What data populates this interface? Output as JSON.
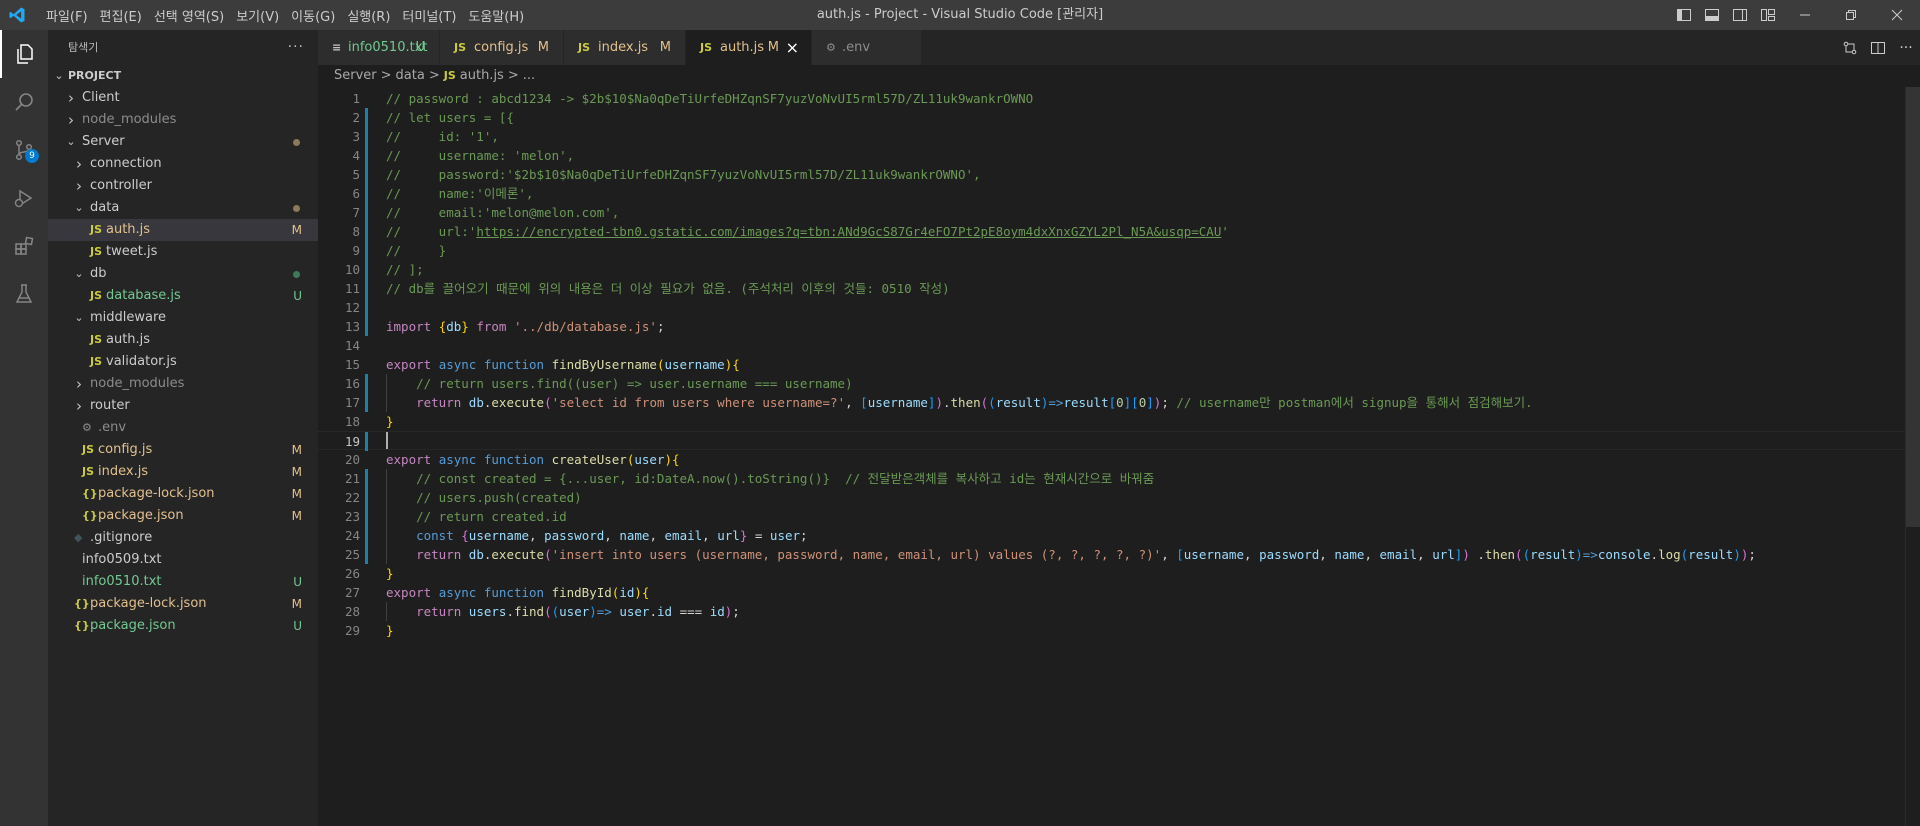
{
  "window": {
    "title": "auth.js - Project - Visual Studio Code [관리자]",
    "menu": [
      "파일(F)",
      "편집(E)",
      "선택 영역(S)",
      "보기(V)",
      "이동(G)",
      "실행(R)",
      "터미널(T)",
      "도움말(H)"
    ]
  },
  "colors": {
    "accent": "#007acc",
    "modified": "#e2c08d",
    "untracked": "#73c991",
    "editor_bg": "#1e1e1e",
    "sidebar_bg": "#252526"
  },
  "activity": {
    "scm_badge": "9"
  },
  "explorer": {
    "title": "탐색기",
    "more": "···",
    "project": "PROJECT",
    "items": [
      {
        "label": "Client",
        "kind": "folder",
        "open": false,
        "depth": 1,
        "status": ""
      },
      {
        "label": "node_modules",
        "kind": "folder",
        "open": false,
        "depth": 1,
        "status": "",
        "dim": true
      },
      {
        "label": "Server",
        "kind": "folder",
        "open": true,
        "depth": 1,
        "status": "dot"
      },
      {
        "label": "connection",
        "kind": "folder",
        "open": false,
        "depth": 2,
        "status": ""
      },
      {
        "label": "controller",
        "kind": "folder",
        "open": false,
        "depth": 2,
        "status": ""
      },
      {
        "label": "data",
        "kind": "folder",
        "open": true,
        "depth": 2,
        "status": "dot"
      },
      {
        "label": "auth.js",
        "kind": "js",
        "depth": 3,
        "status": "M",
        "selected": true
      },
      {
        "label": "tweet.js",
        "kind": "js",
        "depth": 3,
        "status": ""
      },
      {
        "label": "db",
        "kind": "folder",
        "open": true,
        "depth": 2,
        "status": "dot-green"
      },
      {
        "label": "database.js",
        "kind": "js",
        "depth": 3,
        "status": "U"
      },
      {
        "label": "middleware",
        "kind": "folder",
        "open": true,
        "depth": 2,
        "status": ""
      },
      {
        "label": "auth.js",
        "kind": "js",
        "depth": 3,
        "status": ""
      },
      {
        "label": "validator.js",
        "kind": "js",
        "depth": 3,
        "status": ""
      },
      {
        "label": "node_modules",
        "kind": "folder",
        "open": false,
        "depth": 2,
        "status": "",
        "dim": true
      },
      {
        "label": "router",
        "kind": "folder",
        "open": false,
        "depth": 2,
        "status": ""
      },
      {
        "label": ".env",
        "kind": "env",
        "depth": 2,
        "status": "",
        "dim": true
      },
      {
        "label": "config.js",
        "kind": "js",
        "depth": 2,
        "status": "M"
      },
      {
        "label": "index.js",
        "kind": "js",
        "depth": 2,
        "status": "M"
      },
      {
        "label": "package-lock.json",
        "kind": "json",
        "depth": 2,
        "status": "M"
      },
      {
        "label": "package.json",
        "kind": "json",
        "depth": 2,
        "status": "M"
      },
      {
        "label": ".gitignore",
        "kind": "git",
        "depth": 1,
        "status": ""
      },
      {
        "label": "info0509.txt",
        "kind": "txt",
        "depth": 1,
        "status": ""
      },
      {
        "label": "info0510.txt",
        "kind": "txt",
        "depth": 1,
        "status": "U"
      },
      {
        "label": "package-lock.json",
        "kind": "json",
        "depth": 1,
        "status": "M"
      },
      {
        "label": "package.json",
        "kind": "json",
        "depth": 1,
        "status": "U"
      }
    ]
  },
  "tabs": [
    {
      "label": "info0510.txt",
      "status": "U",
      "kind": "txt"
    },
    {
      "label": "config.js",
      "status": "M",
      "kind": "js"
    },
    {
      "label": "index.js",
      "status": "M",
      "kind": "js"
    },
    {
      "label": "auth.js",
      "status": "M",
      "kind": "js",
      "active": true,
      "close": "×"
    },
    {
      "label": ".env",
      "status": "",
      "kind": "env"
    }
  ],
  "breadcrumb": [
    "Server",
    ">",
    "data",
    ">",
    "JS",
    "auth.js",
    ">",
    "..."
  ],
  "editor": {
    "cursor_line": 19,
    "lines": [
      [
        [
          "cm",
          "// password : abcd1234 -> $2b$10$Na0qDeTiUrfeDHZqnSF7yuzVoNvUI5rml57D/ZL11uk9wankrOWNO"
        ]
      ],
      [
        [
          "cm",
          "// let users = [{"
        ]
      ],
      [
        [
          "cm",
          "//     id: '1',"
        ]
      ],
      [
        [
          "cm",
          "//     username: 'melon',"
        ]
      ],
      [
        [
          "cm",
          "//     password:'$2b$10$Na0qDeTiUrfeDHZqnSF7yuzVoNvUI5rml57D/ZL11uk9wankrOWNO',"
        ]
      ],
      [
        [
          "cm",
          "//     name:'이메론',"
        ]
      ],
      [
        [
          "cm",
          "//     email:'melon@melon.com',"
        ]
      ],
      [
        [
          "cm",
          "//     url:'"
        ],
        [
          "cmu",
          "https://encrypted-tbn0.gstatic.com/images?q=tbn:ANd9GcS87Gr4eFO7Pt2pE8oym4dxXnxGZYL2Pl_N5A&usqp=CAU"
        ],
        [
          "cm",
          "'"
        ]
      ],
      [
        [
          "cm",
          "//     }"
        ]
      ],
      [
        [
          "cm",
          "// ];"
        ]
      ],
      [
        [
          "cm",
          "// db를 끌어오기 때문에 위의 내용은 더 이상 필요가 없음. (주석처리 이후의 것들: 0510 작성)"
        ]
      ],
      [],
      [
        [
          "k2",
          "import "
        ],
        [
          "p1",
          "{"
        ],
        [
          "vr",
          "db"
        ],
        [
          "p1",
          "}"
        ],
        [
          "k2",
          " from "
        ],
        [
          "st2",
          "'../db/database.js'"
        ],
        [
          "pl",
          ";"
        ]
      ],
      [],
      [
        [
          "k2",
          "export "
        ],
        [
          "k1",
          "async function "
        ],
        [
          "fn",
          "findByUsername"
        ],
        [
          "p1",
          "("
        ],
        [
          "vr",
          "username"
        ],
        [
          "p1",
          "){"
        ]
      ],
      [
        [
          "pl",
          "    "
        ],
        [
          "cm",
          "// return users.find((user) => user.username === username)"
        ]
      ],
      [
        [
          "pl",
          "    "
        ],
        [
          "k2",
          "return "
        ],
        [
          "vr",
          "db"
        ],
        [
          "pl",
          "."
        ],
        [
          "fn",
          "execute"
        ],
        [
          "p2",
          "("
        ],
        [
          "st2",
          "'select id from users where username=?'"
        ],
        [
          "pl",
          ", "
        ],
        [
          "p3",
          "["
        ],
        [
          "vr",
          "username"
        ],
        [
          "p3",
          "]"
        ],
        [
          "p2",
          ")"
        ],
        [
          "pl",
          "."
        ],
        [
          "fn",
          "then"
        ],
        [
          "p2",
          "("
        ],
        [
          "p3",
          "("
        ],
        [
          "vr",
          "result"
        ],
        [
          "p3",
          ")"
        ],
        [
          "k1",
          "=>"
        ],
        [
          "vr",
          "result"
        ],
        [
          "p3",
          "["
        ],
        [
          "nm",
          "0"
        ],
        [
          "p3",
          "]["
        ],
        [
          "nm",
          "0"
        ],
        [
          "p3",
          "]"
        ],
        [
          "p2",
          ")"
        ],
        [
          "pl",
          "; "
        ],
        [
          "cm",
          "// username만 postman에서 signup을 통해서 점검해보기."
        ]
      ],
      [
        [
          "p1",
          "}"
        ]
      ],
      [],
      [
        [
          "k2",
          "export "
        ],
        [
          "k1",
          "async function "
        ],
        [
          "fn",
          "createUser"
        ],
        [
          "p1",
          "("
        ],
        [
          "vr",
          "user"
        ],
        [
          "p1",
          "){"
        ]
      ],
      [
        [
          "pl",
          "    "
        ],
        [
          "cm",
          "// const created = {...user, id:DateA.now().toString()}  // 전달받은객체를 복사하고 id는 현재시간으로 바꿔줌"
        ]
      ],
      [
        [
          "pl",
          "    "
        ],
        [
          "cm",
          "// users.push(created)"
        ]
      ],
      [
        [
          "pl",
          "    "
        ],
        [
          "cm",
          "// return created.id"
        ]
      ],
      [
        [
          "pl",
          "    "
        ],
        [
          "k1",
          "const "
        ],
        [
          "p2",
          "{"
        ],
        [
          "vr",
          "username"
        ],
        [
          "pl",
          ", "
        ],
        [
          "vr",
          "password"
        ],
        [
          "pl",
          ", "
        ],
        [
          "vr",
          "name"
        ],
        [
          "pl",
          ", "
        ],
        [
          "vr",
          "email"
        ],
        [
          "pl",
          ", "
        ],
        [
          "vr",
          "url"
        ],
        [
          "p2",
          "}"
        ],
        [
          "pl",
          " = "
        ],
        [
          "vr",
          "user"
        ],
        [
          "pl",
          ";"
        ]
      ],
      [
        [
          "pl",
          "    "
        ],
        [
          "k2",
          "return "
        ],
        [
          "vr",
          "db"
        ],
        [
          "pl",
          "."
        ],
        [
          "fn",
          "execute"
        ],
        [
          "p2",
          "("
        ],
        [
          "st2",
          "'insert into users (username, password, name, email, url) values (?, ?, ?, ?, ?)'"
        ],
        [
          "pl",
          ", "
        ],
        [
          "p3",
          "["
        ],
        [
          "vr",
          "username"
        ],
        [
          "pl",
          ", "
        ],
        [
          "vr",
          "password"
        ],
        [
          "pl",
          ", "
        ],
        [
          "vr",
          "name"
        ],
        [
          "pl",
          ", "
        ],
        [
          "vr",
          "email"
        ],
        [
          "pl",
          ", "
        ],
        [
          "vr",
          "url"
        ],
        [
          "p3",
          "]"
        ],
        [
          "p2",
          ")"
        ],
        [
          "pl",
          " ."
        ],
        [
          "fn",
          "then"
        ],
        [
          "p2",
          "("
        ],
        [
          "p3",
          "("
        ],
        [
          "vr",
          "result"
        ],
        [
          "p3",
          ")"
        ],
        [
          "k1",
          "=>"
        ],
        [
          "vr",
          "console"
        ],
        [
          "pl",
          "."
        ],
        [
          "fn",
          "log"
        ],
        [
          "p3",
          "("
        ],
        [
          "vr",
          "result"
        ],
        [
          "p3",
          ")"
        ],
        [
          "p2",
          ")"
        ],
        [
          "pl",
          ";"
        ]
      ],
      [
        [
          "p1",
          "}"
        ]
      ],
      [
        [
          "k2",
          "export "
        ],
        [
          "k1",
          "async function "
        ],
        [
          "fn",
          "findById"
        ],
        [
          "p1",
          "("
        ],
        [
          "vr",
          "id"
        ],
        [
          "p1",
          "){"
        ]
      ],
      [
        [
          "pl",
          "    "
        ],
        [
          "k2",
          "return "
        ],
        [
          "vr",
          "users"
        ],
        [
          "pl",
          "."
        ],
        [
          "fn",
          "find"
        ],
        [
          "p2",
          "("
        ],
        [
          "p3",
          "("
        ],
        [
          "vr",
          "user"
        ],
        [
          "p3",
          ")"
        ],
        [
          "k1",
          "=> "
        ],
        [
          "vr",
          "user"
        ],
        [
          "pl",
          "."
        ],
        [
          "vr",
          "id"
        ],
        [
          "pl",
          " === "
        ],
        [
          "vr",
          "id"
        ],
        [
          "p2",
          ")"
        ],
        [
          "pl",
          ";"
        ]
      ],
      [
        [
          "p1",
          "}"
        ]
      ]
    ]
  }
}
